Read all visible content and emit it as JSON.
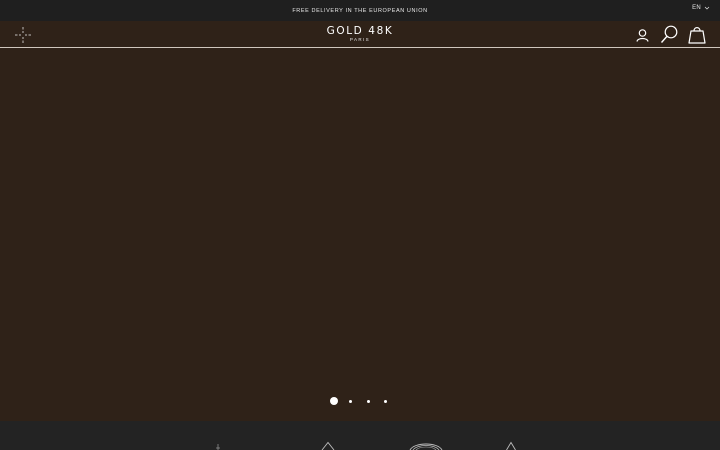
{
  "announcement": {
    "text": "FREE DELIVERY IN THE EUROPEAN UNION"
  },
  "language": {
    "selected": "EN",
    "icon": "chevron-down-icon"
  },
  "header": {
    "logo_brand": "GOLD 48K",
    "logo_city": "PARIS",
    "icons": [
      "menu-icon",
      "account-icon",
      "search-icon",
      "shopping-bag-icon"
    ]
  },
  "carousel": {
    "slide_count": 4,
    "active_index": 0
  },
  "colors": {
    "topbar": "#1f1f1f",
    "hero": "#2f2218",
    "footer": "#232323",
    "accent": "#ffffff"
  },
  "feature_icons": [
    "arrow-down-icon",
    "mountain-icon",
    "arch-icon",
    "drop-icon"
  ]
}
